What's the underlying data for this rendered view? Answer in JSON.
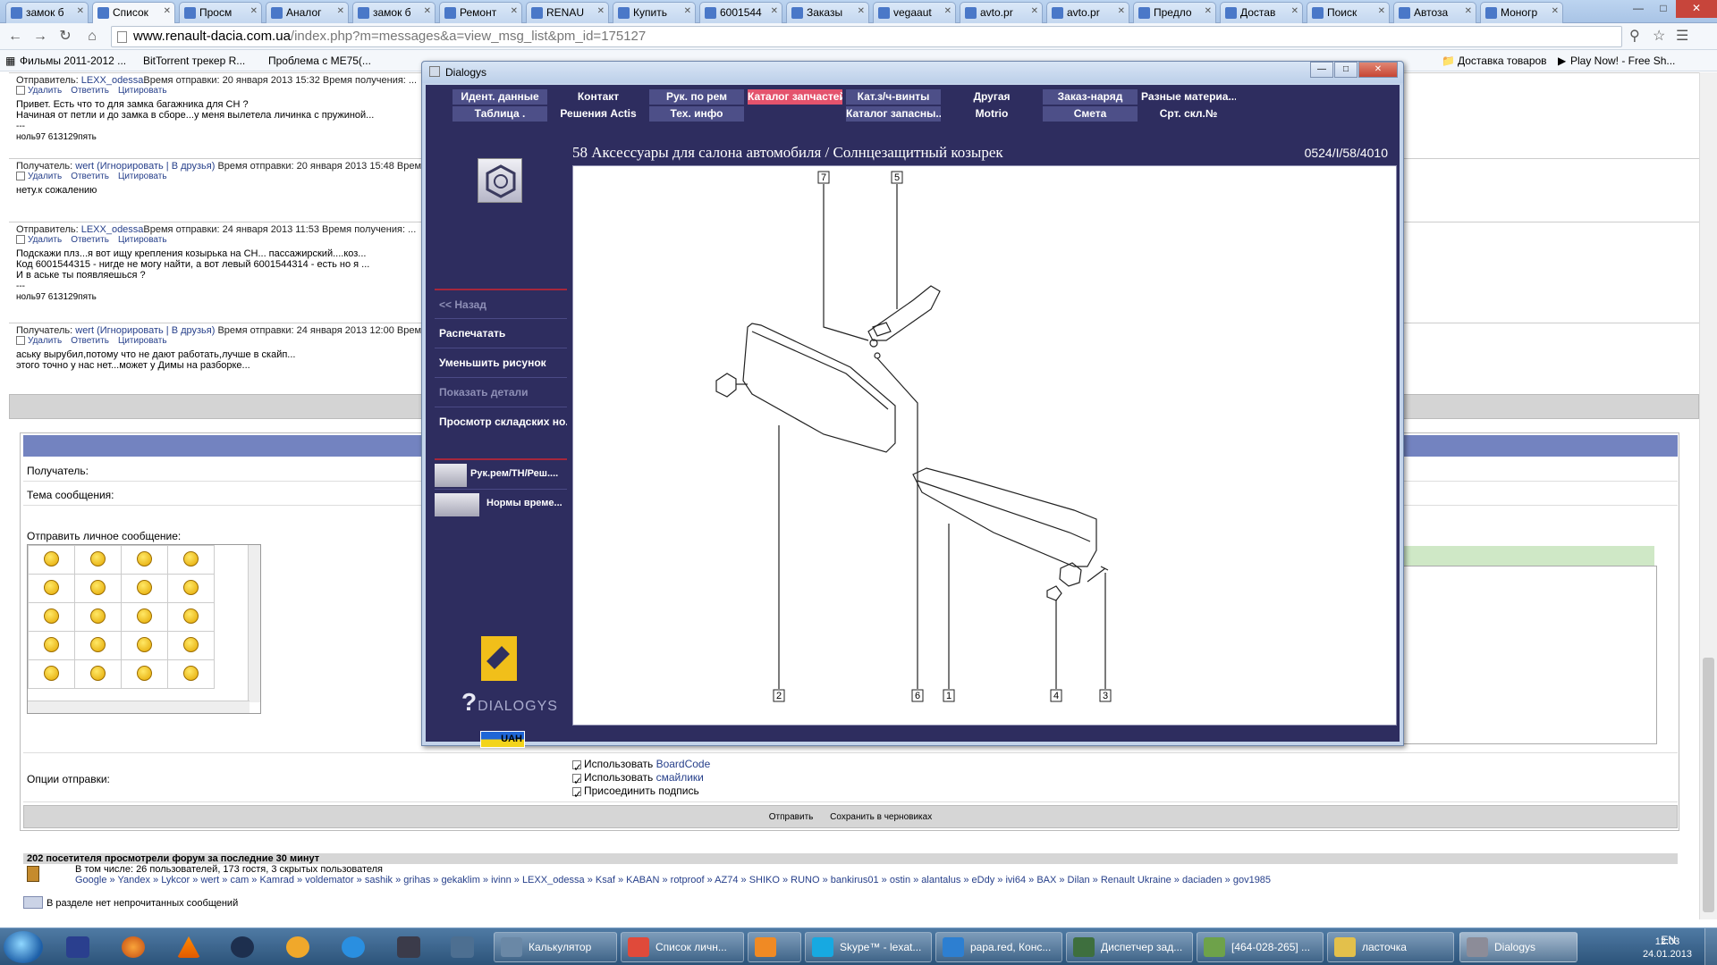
{
  "browser": {
    "tabs": [
      {
        "label": "замок б"
      },
      {
        "label": "Список"
      },
      {
        "label": "Просм"
      },
      {
        "label": "Аналог"
      },
      {
        "label": "замок б"
      },
      {
        "label": "Ремонт"
      },
      {
        "label": "RENAU"
      },
      {
        "label": "Купить"
      },
      {
        "label": "6001544"
      },
      {
        "label": "Заказы"
      },
      {
        "label": "vegaaut"
      },
      {
        "label": "avto.pr"
      },
      {
        "label": "avto.pr"
      },
      {
        "label": "Предло"
      },
      {
        "label": "Достав"
      },
      {
        "label": "Поиск"
      },
      {
        "label": "Автоза"
      },
      {
        "label": "Моногр"
      }
    ],
    "url_host": "www.renault-dacia.com.ua",
    "url_path": "/index.php?m=messages&a=view_msg_list&pm_id=175127",
    "bookmarks": [
      {
        "label": "Фильмы 2011-2012 ..."
      },
      {
        "label": "BitTorrent трекер R..."
      },
      {
        "label": "Проблема с МЕ75(..."
      }
    ],
    "bookmarks_right": [
      {
        "label": "Доставка товаров"
      },
      {
        "label": "Play Now! - Free Sh..."
      }
    ]
  },
  "forum": {
    "messages": [
      {
        "head_prefix": "Отправитель: ",
        "head_user": "LEXX_odessa",
        "head_suffix": "Время отправки: 20 января 2013 15:32   Время получения: ...",
        "actions": [
          "Удалить",
          "Ответить",
          "Цитировать"
        ],
        "body": [
          "Привет. Есть что то для замка багажника для CH ?",
          "Начиная от петли и до замка в сборе...у меня вылетела личинка с пружиной..."
        ],
        "sig": [
          "---",
          "ноль97 613129пять"
        ]
      },
      {
        "head_prefix": "Получатель: ",
        "head_user": "wert (Игнорировать | В друзья)",
        "head_suffix": " Время отправки: 20 января 2013 15:48   Время получения: ...",
        "actions": [
          "Удалить",
          "Ответить",
          "Цитировать"
        ],
        "body": [
          "нету.к сожалению"
        ],
        "sig": []
      },
      {
        "head_prefix": "Отправитель: ",
        "head_user": "LEXX_odessa",
        "head_suffix": "Время отправки: 24 января 2013 11:53   Время получения: ...",
        "actions": [
          "Удалить",
          "Ответить",
          "Цитировать"
        ],
        "body": [
          "Подскажи плз...я вот ищу крепления козырька на CH... пассажирский....коз...",
          "Код 6001544315 - нигде не могу найти, а вот левый 6001544314 - есть но я ...",
          "И в аське ты появляешься ?"
        ],
        "sig": [
          "---",
          "ноль97 613129пять"
        ]
      },
      {
        "head_prefix": "Получатель: ",
        "head_user": "wert (Игнорировать | В друзья)",
        "head_suffix": " Время отправки: 24 января 2013 12:00   Время получения: ...",
        "actions": [
          "Удалить",
          "Ответить",
          "Цитировать"
        ],
        "body": [
          "аську вырубил,потому что не дают работать,лучше в скайп...",
          "этого точно у нас нет...может у Димы на разборке..."
        ],
        "sig": []
      }
    ],
    "form": {
      "recipient_label": "Получатель:",
      "subject_label": "Тема сообщения:",
      "message_label": "Отправить личное сообщение:",
      "options_label": "Опции отправки:",
      "opt1_prefix": "Использовать ",
      "opt1_link": "BoardCode",
      "opt2_prefix": "Использовать ",
      "opt2_link": "смайлики",
      "opt3": "Присоединить подпись",
      "send_button": "Отправить",
      "draft_button": "Сохранить в черновиках"
    },
    "stats": {
      "title": "202 посетителя просмотрели форум за последние 30 минут",
      "sub": "В том числе: 26 пользователей, 173 гостя, 3 скрытых пользователя",
      "users": "Google » Yandex » Lykcor » wert » cam » Kamrad » voldemator » sashik » grihas » gekaklim » ivinn » LEXX_odessa » Ksaf » KABAN » rotproof » AZ74 » SHIKO » RUNO » bankirus01 » ostin » alantalus » eDdy » ivi64 » BAX » Dilan » Renault Ukraine » daciaden » gov1985",
      "unread": "В разделе нет непрочитанных сообщений"
    }
  },
  "dialogys": {
    "window_title": "Dialogys",
    "menu_row1": [
      "Идент. данные",
      "Контакт",
      "Рук. по рем",
      "Каталог запчастей",
      "Кат.з/ч-винты",
      "Другая",
      "Заказ-наряд",
      "Разные материа..."
    ],
    "menu_row2": [
      "Таблица .",
      "Решения Actis",
      "Тех. инфо",
      "",
      "Каталог запасны...",
      "Motrio",
      "Смета",
      "Срт. скл.№"
    ],
    "selected_menu": "Каталог запчастей",
    "sidebar": {
      "back": "<< Назад",
      "print": "Распечатать",
      "zoom_out": "Уменьшить рисунок",
      "show_details": "Показать детали",
      "stock_view": "Просмотр складских но...",
      "manuals": "Рук.рем/ТН/Реш....",
      "time_norms": "Нормы време..."
    },
    "content_title": "58 Аксессуары для салона автомобиля / Солнцезащитный козырек",
    "content_code": "0524/I/58/4010",
    "brand": "DIALOGYS",
    "currency": "UAH",
    "callouts": [
      "7",
      "5",
      "2",
      "6",
      "1",
      "4",
      "3"
    ]
  },
  "taskbar": {
    "apps": [
      {
        "label": "Калькулятор"
      },
      {
        "label": "Список личн..."
      },
      {
        "label": ""
      },
      {
        "label": "Skype™ - lexat..."
      },
      {
        "label": "papa.red, Конс..."
      },
      {
        "label": "Диспетчер зад..."
      },
      {
        "label": "[464-028-265] ..."
      },
      {
        "label": "ласточка"
      },
      {
        "label": "Dialogys"
      }
    ],
    "lang": "EN",
    "time": "12:03",
    "date": "24.01.2013"
  }
}
